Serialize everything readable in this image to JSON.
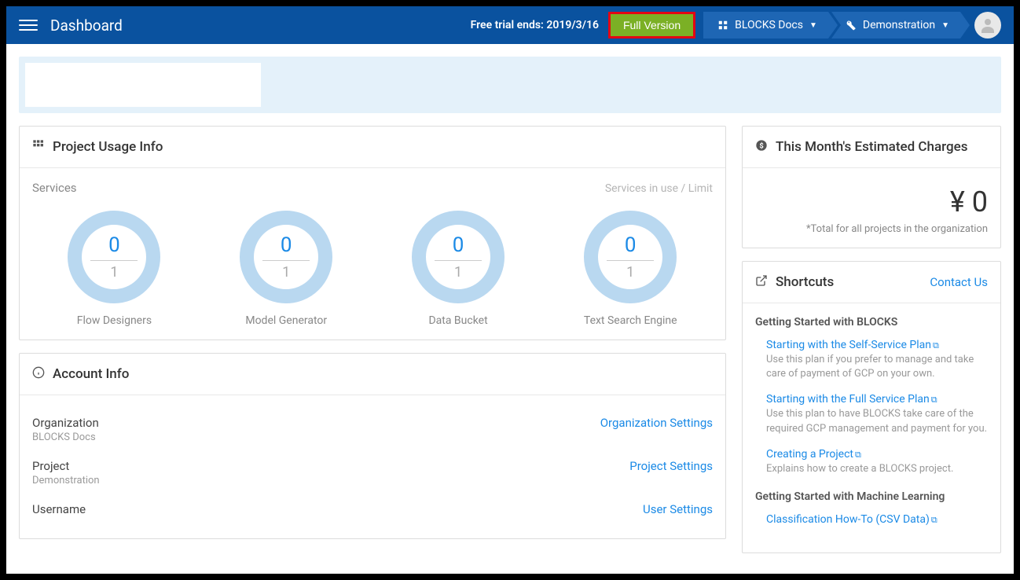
{
  "header": {
    "title": "Dashboard",
    "trial_text": "Free trial ends: 2019/3/16",
    "full_version_label": "Full Version",
    "breadcrumb": [
      {
        "label": "BLOCKS Docs",
        "icon": "org"
      },
      {
        "label": "Demonstration",
        "icon": "wrench"
      }
    ]
  },
  "usage": {
    "title": "Project Usage Info",
    "services_label": "Services",
    "services_limit_label": "Services in use / Limit",
    "items": [
      {
        "name": "Flow Designers",
        "used": "0",
        "limit": "1"
      },
      {
        "name": "Model Generator",
        "used": "0",
        "limit": "1"
      },
      {
        "name": "Data Bucket",
        "used": "0",
        "limit": "1"
      },
      {
        "name": "Text Search Engine",
        "used": "0",
        "limit": "1"
      }
    ]
  },
  "account": {
    "title": "Account Info",
    "rows": [
      {
        "label": "Organization",
        "value": "BLOCKS Docs",
        "link": "Organization Settings"
      },
      {
        "label": "Project",
        "value": "Demonstration",
        "link": "Project Settings"
      },
      {
        "label": "Username",
        "value": "",
        "link": "User Settings"
      }
    ]
  },
  "charges": {
    "title": "This Month's Estimated Charges",
    "amount": "¥ 0",
    "note": "*Total for all projects in the organization"
  },
  "shortcuts": {
    "title": "Shortcuts",
    "contact_label": "Contact Us",
    "sections": [
      {
        "heading": "Getting Started with BLOCKS",
        "items": [
          {
            "link": "Starting with the Self-Service Plan",
            "desc": "Use this plan if you prefer to manage and take care of payment of GCP on your own."
          },
          {
            "link": "Starting with the Full Service Plan",
            "desc": "Use this plan to have BLOCKS take care of the required GCP management and payment for you."
          },
          {
            "link": "Creating a Project",
            "desc": "Explains how to create a BLOCKS project."
          }
        ]
      },
      {
        "heading": "Getting Started with Machine Learning",
        "items": [
          {
            "link": "Classification How-To (CSV Data)",
            "desc": ""
          }
        ]
      }
    ]
  }
}
